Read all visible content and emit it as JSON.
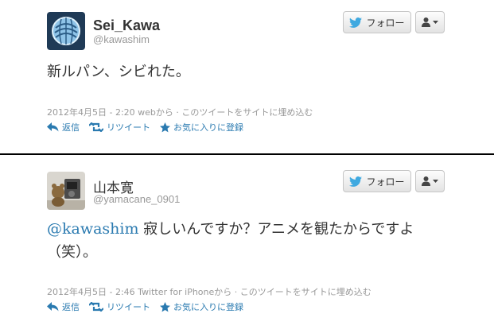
{
  "tweets": [
    {
      "display_name": "Sei_Kawa",
      "username": "@kawashim",
      "text": "新ルパン、シビれた。",
      "timestamp": "2012年4月5日 - 2:20",
      "source": "webから",
      "embed_label": "· このツイートをサイトに埋め込む",
      "follow_label": "フォロー",
      "actions": {
        "reply": "返信",
        "retweet": "リツイート",
        "favorite": "お気に入りに登録"
      }
    },
    {
      "display_name": "山本寛",
      "username": "@yamacane_0901",
      "mention": "@kawashim",
      "text_line1": " 寂しいんですか？アニメを観たからですよ",
      "text_line2": "（笑）。",
      "timestamp": "2012年4月5日 - 2:46",
      "source": "Twitter for iPhoneから",
      "embed_label": "· このツイートをサイトに埋め込む",
      "follow_label": "フォロー",
      "actions": {
        "reply": "返信",
        "retweet": "リツイート",
        "favorite": "お気に入りに登録"
      }
    }
  ],
  "colors": {
    "link": "#2a7ab0",
    "action_icon": "#2a7ab0",
    "twitter_bird": "#3fa9e0",
    "divider": "#000000"
  }
}
